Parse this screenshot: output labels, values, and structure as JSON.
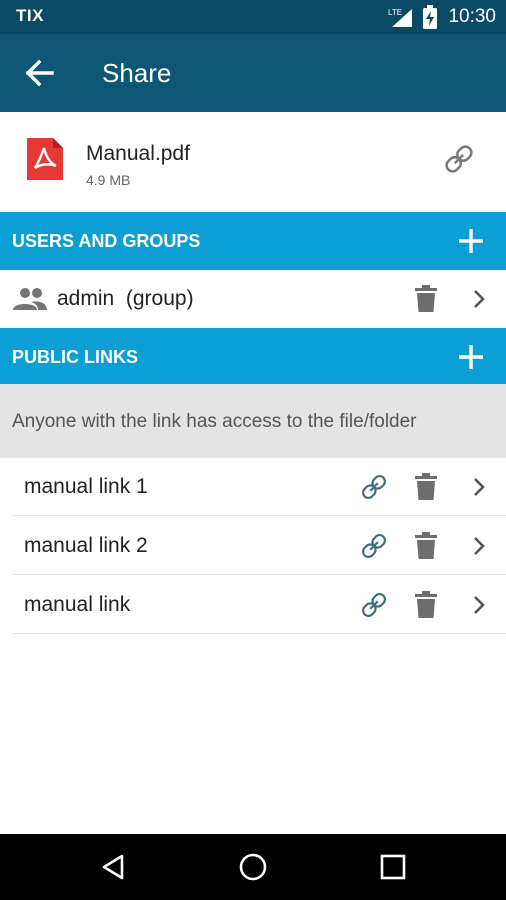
{
  "status_bar": {
    "carrier": "TIX",
    "network": "LTE",
    "time": "10:30",
    "icons": [
      "signal-icon",
      "battery-charging-icon"
    ]
  },
  "app_bar": {
    "title": "Share",
    "back_icon": "arrow-back-icon",
    "background": "#0e5675"
  },
  "file": {
    "name": "Manual.pdf",
    "size": "4.9 MB",
    "icon": "pdf-icon",
    "icon_color": "#e53935",
    "action_icon": "link-icon"
  },
  "sections": {
    "users_and_groups": {
      "title": "USERS AND GROUPS",
      "add_icon": "plus-icon"
    },
    "public_links": {
      "title": "PUBLIC LINKS",
      "add_icon": "plus-icon"
    },
    "accent": "#0b9fd6"
  },
  "users": [
    {
      "name": "admin",
      "type": "(group)",
      "icon": "group-icon"
    }
  ],
  "public_links_notice": "Anyone with the link has access to the file/folder",
  "public_links": [
    {
      "label": "manual link 1"
    },
    {
      "label": "manual link 2"
    },
    {
      "label": "manual link"
    }
  ],
  "nav_bar": {
    "buttons": [
      "back-triangle-icon",
      "home-circle-icon",
      "recents-square-icon"
    ]
  }
}
